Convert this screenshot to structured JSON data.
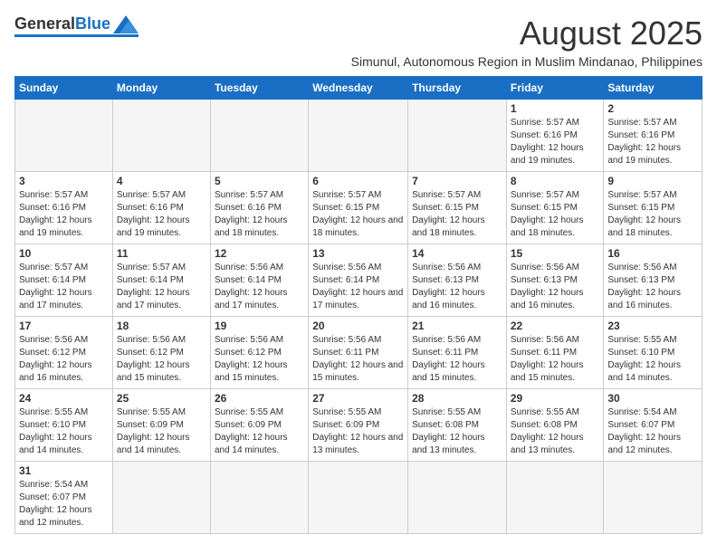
{
  "logo": {
    "general": "General",
    "blue": "Blue"
  },
  "title": {
    "month_year": "August 2025",
    "subtitle": "Simunul, Autonomous Region in Muslim Mindanao, Philippines"
  },
  "header_days": [
    "Sunday",
    "Monday",
    "Tuesday",
    "Wednesday",
    "Thursday",
    "Friday",
    "Saturday"
  ],
  "weeks": [
    [
      {
        "date": "",
        "info": ""
      },
      {
        "date": "",
        "info": ""
      },
      {
        "date": "",
        "info": ""
      },
      {
        "date": "",
        "info": ""
      },
      {
        "date": "",
        "info": ""
      },
      {
        "date": "1",
        "info": "Sunrise: 5:57 AM\nSunset: 6:16 PM\nDaylight: 12 hours and 19 minutes."
      },
      {
        "date": "2",
        "info": "Sunrise: 5:57 AM\nSunset: 6:16 PM\nDaylight: 12 hours and 19 minutes."
      }
    ],
    [
      {
        "date": "3",
        "info": "Sunrise: 5:57 AM\nSunset: 6:16 PM\nDaylight: 12 hours and 19 minutes."
      },
      {
        "date": "4",
        "info": "Sunrise: 5:57 AM\nSunset: 6:16 PM\nDaylight: 12 hours and 19 minutes."
      },
      {
        "date": "5",
        "info": "Sunrise: 5:57 AM\nSunset: 6:16 PM\nDaylight: 12 hours and 18 minutes."
      },
      {
        "date": "6",
        "info": "Sunrise: 5:57 AM\nSunset: 6:15 PM\nDaylight: 12 hours and 18 minutes."
      },
      {
        "date": "7",
        "info": "Sunrise: 5:57 AM\nSunset: 6:15 PM\nDaylight: 12 hours and 18 minutes."
      },
      {
        "date": "8",
        "info": "Sunrise: 5:57 AM\nSunset: 6:15 PM\nDaylight: 12 hours and 18 minutes."
      },
      {
        "date": "9",
        "info": "Sunrise: 5:57 AM\nSunset: 6:15 PM\nDaylight: 12 hours and 18 minutes."
      }
    ],
    [
      {
        "date": "10",
        "info": "Sunrise: 5:57 AM\nSunset: 6:14 PM\nDaylight: 12 hours and 17 minutes."
      },
      {
        "date": "11",
        "info": "Sunrise: 5:57 AM\nSunset: 6:14 PM\nDaylight: 12 hours and 17 minutes."
      },
      {
        "date": "12",
        "info": "Sunrise: 5:56 AM\nSunset: 6:14 PM\nDaylight: 12 hours and 17 minutes."
      },
      {
        "date": "13",
        "info": "Sunrise: 5:56 AM\nSunset: 6:14 PM\nDaylight: 12 hours and 17 minutes."
      },
      {
        "date": "14",
        "info": "Sunrise: 5:56 AM\nSunset: 6:13 PM\nDaylight: 12 hours and 16 minutes."
      },
      {
        "date": "15",
        "info": "Sunrise: 5:56 AM\nSunset: 6:13 PM\nDaylight: 12 hours and 16 minutes."
      },
      {
        "date": "16",
        "info": "Sunrise: 5:56 AM\nSunset: 6:13 PM\nDaylight: 12 hours and 16 minutes."
      }
    ],
    [
      {
        "date": "17",
        "info": "Sunrise: 5:56 AM\nSunset: 6:12 PM\nDaylight: 12 hours and 16 minutes."
      },
      {
        "date": "18",
        "info": "Sunrise: 5:56 AM\nSunset: 6:12 PM\nDaylight: 12 hours and 15 minutes."
      },
      {
        "date": "19",
        "info": "Sunrise: 5:56 AM\nSunset: 6:12 PM\nDaylight: 12 hours and 15 minutes."
      },
      {
        "date": "20",
        "info": "Sunrise: 5:56 AM\nSunset: 6:11 PM\nDaylight: 12 hours and 15 minutes."
      },
      {
        "date": "21",
        "info": "Sunrise: 5:56 AM\nSunset: 6:11 PM\nDaylight: 12 hours and 15 minutes."
      },
      {
        "date": "22",
        "info": "Sunrise: 5:56 AM\nSunset: 6:11 PM\nDaylight: 12 hours and 15 minutes."
      },
      {
        "date": "23",
        "info": "Sunrise: 5:55 AM\nSunset: 6:10 PM\nDaylight: 12 hours and 14 minutes."
      }
    ],
    [
      {
        "date": "24",
        "info": "Sunrise: 5:55 AM\nSunset: 6:10 PM\nDaylight: 12 hours and 14 minutes."
      },
      {
        "date": "25",
        "info": "Sunrise: 5:55 AM\nSunset: 6:09 PM\nDaylight: 12 hours and 14 minutes."
      },
      {
        "date": "26",
        "info": "Sunrise: 5:55 AM\nSunset: 6:09 PM\nDaylight: 12 hours and 14 minutes."
      },
      {
        "date": "27",
        "info": "Sunrise: 5:55 AM\nSunset: 6:09 PM\nDaylight: 12 hours and 13 minutes."
      },
      {
        "date": "28",
        "info": "Sunrise: 5:55 AM\nSunset: 6:08 PM\nDaylight: 12 hours and 13 minutes."
      },
      {
        "date": "29",
        "info": "Sunrise: 5:55 AM\nSunset: 6:08 PM\nDaylight: 12 hours and 13 minutes."
      },
      {
        "date": "30",
        "info": "Sunrise: 5:54 AM\nSunset: 6:07 PM\nDaylight: 12 hours and 12 minutes."
      }
    ],
    [
      {
        "date": "31",
        "info": "Sunrise: 5:54 AM\nSunset: 6:07 PM\nDaylight: 12 hours and 12 minutes."
      },
      {
        "date": "",
        "info": ""
      },
      {
        "date": "",
        "info": ""
      },
      {
        "date": "",
        "info": ""
      },
      {
        "date": "",
        "info": ""
      },
      {
        "date": "",
        "info": ""
      },
      {
        "date": "",
        "info": ""
      }
    ]
  ]
}
